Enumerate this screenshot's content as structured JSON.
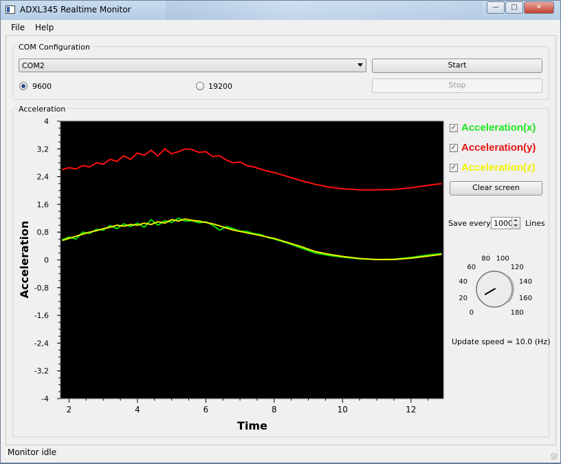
{
  "window": {
    "title": "ADXL345 Realtime Monitor",
    "minimize_glyph": "—",
    "maximize_glyph": "□",
    "close_glyph": "✕"
  },
  "menu": {
    "file": "File",
    "help": "Help"
  },
  "com": {
    "group_title": "COM Configuration",
    "port_selected": "COM2",
    "start_label": "Start",
    "stop_label": "Stop",
    "baud_options": [
      "9600",
      "19200"
    ],
    "baud_selected": "9600"
  },
  "acceleration": {
    "group_title": "Acceleration",
    "chart_data": {
      "type": "line",
      "xlabel": "Time",
      "ylabel": "Acceleration",
      "xlim": [
        1.75,
        12.95
      ],
      "ylim": [
        -4,
        4
      ],
      "x_ticks": [
        "2",
        "4",
        "6",
        "8",
        "10",
        "12"
      ],
      "y_ticks": [
        "4",
        "3,2",
        "2,4",
        "1,6",
        "0,8",
        "0",
        "-0,8",
        "-1,6",
        "-2,4",
        "-3,2",
        "-4"
      ],
      "background": "#000000",
      "series": [
        {
          "name": "Acceleration(x)",
          "color": "#00e000",
          "x": [
            1.8,
            2.0,
            2.2,
            2.4,
            2.6,
            2.8,
            3.0,
            3.2,
            3.4,
            3.6,
            3.8,
            4.0,
            4.2,
            4.4,
            4.6,
            4.8,
            5.0,
            5.2,
            5.4,
            5.6,
            5.8,
            6.0,
            6.2,
            6.4,
            6.6,
            6.8,
            7.0,
            7.2,
            7.4,
            7.6,
            7.8,
            8.0,
            8.4,
            8.8,
            9.2,
            9.6,
            10.0,
            10.5,
            11.0,
            11.5,
            12.0,
            12.5,
            12.9
          ],
          "y": [
            0.58,
            0.66,
            0.6,
            0.8,
            0.76,
            0.88,
            0.86,
            0.99,
            0.9,
            1.04,
            0.96,
            1.06,
            0.94,
            1.16,
            1.0,
            1.13,
            1.08,
            1.2,
            1.12,
            1.13,
            1.07,
            1.1,
            1.0,
            0.86,
            0.96,
            0.9,
            0.83,
            0.82,
            0.76,
            0.73,
            0.65,
            0.6,
            0.48,
            0.34,
            0.2,
            0.13,
            0.08,
            0.03,
            0.01,
            0.02,
            0.07,
            0.14,
            0.18
          ]
        },
        {
          "name": "Acceleration(y)",
          "color": "#ff1010",
          "x": [
            1.8,
            2.0,
            2.2,
            2.4,
            2.6,
            2.8,
            3.0,
            3.2,
            3.4,
            3.6,
            3.8,
            4.0,
            4.2,
            4.4,
            4.6,
            4.8,
            5.0,
            5.2,
            5.4,
            5.6,
            5.8,
            6.0,
            6.2,
            6.4,
            6.6,
            6.8,
            7.0,
            7.2,
            7.4,
            7.6,
            7.8,
            8.0,
            8.4,
            8.8,
            9.2,
            9.6,
            10.0,
            10.5,
            11.0,
            11.5,
            12.0,
            12.5,
            12.9
          ],
          "y": [
            2.6,
            2.66,
            2.62,
            2.72,
            2.68,
            2.8,
            2.76,
            2.9,
            2.84,
            3.0,
            2.9,
            3.08,
            3.02,
            3.16,
            3.0,
            3.2,
            3.06,
            3.12,
            3.2,
            3.18,
            3.1,
            3.12,
            2.98,
            3.0,
            2.88,
            2.8,
            2.82,
            2.72,
            2.68,
            2.62,
            2.56,
            2.52,
            2.4,
            2.28,
            2.18,
            2.1,
            2.05,
            2.02,
            2.02,
            2.03,
            2.08,
            2.15,
            2.2
          ]
        },
        {
          "name": "Acceleration(z)",
          "color": "#f2f200",
          "x": [
            1.8,
            2.0,
            2.2,
            2.4,
            2.6,
            2.8,
            3.0,
            3.2,
            3.4,
            3.6,
            3.8,
            4.0,
            4.2,
            4.4,
            4.6,
            4.8,
            5.0,
            5.2,
            5.4,
            5.6,
            5.8,
            6.0,
            6.2,
            6.4,
            6.6,
            6.8,
            7.0,
            7.2,
            7.4,
            7.6,
            7.8,
            8.0,
            8.4,
            8.8,
            9.2,
            9.6,
            10.0,
            10.5,
            11.0,
            11.5,
            12.0,
            12.5,
            12.9
          ],
          "y": [
            0.56,
            0.62,
            0.68,
            0.74,
            0.8,
            0.84,
            0.9,
            0.94,
            1.0,
            0.97,
            1.02,
            1.0,
            1.06,
            1.02,
            1.1,
            1.06,
            1.16,
            1.12,
            1.18,
            1.14,
            1.12,
            1.08,
            1.04,
            0.98,
            0.92,
            0.86,
            0.82,
            0.78,
            0.74,
            0.7,
            0.66,
            0.62,
            0.5,
            0.38,
            0.24,
            0.16,
            0.1,
            0.04,
            0.01,
            0.01,
            0.05,
            0.11,
            0.16
          ]
        }
      ]
    },
    "legend": [
      {
        "label": "Acceleration(x)",
        "color": "#1ee61e",
        "checked": true
      },
      {
        "label": "Acceleration(y)",
        "color": "#e81212",
        "checked": true
      },
      {
        "label": "Acceleration(z)",
        "color": "#f2f200",
        "checked": true
      }
    ],
    "clear_label": "Clear screen",
    "save_prefix": "Save every",
    "save_value": "1000",
    "save_suffix": "Lines",
    "dial": {
      "min": 0,
      "max": 180,
      "value": 10,
      "labels": [
        "0",
        "20",
        "40",
        "60",
        "80",
        "100",
        "120",
        "140",
        "160",
        "180"
      ]
    },
    "update_speed_text": "Update speed = 10.0 (Hz)"
  },
  "status": {
    "text": "Monitor idle"
  }
}
